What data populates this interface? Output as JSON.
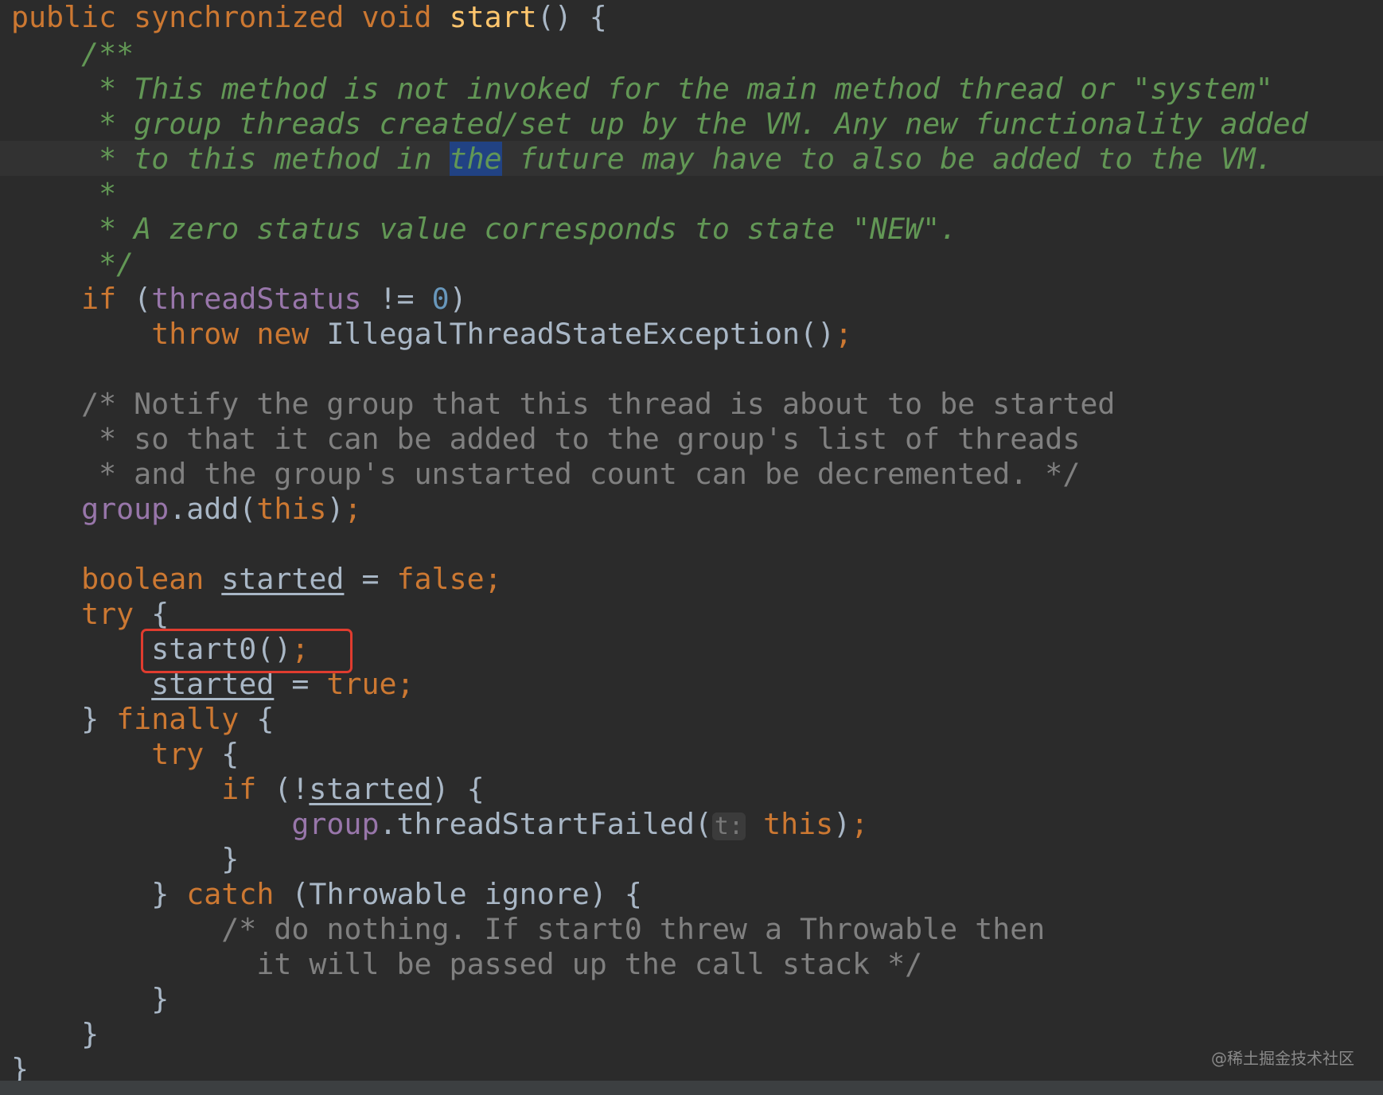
{
  "editor": {
    "watermark": "@稀土掘金技术社区",
    "hint_label": "t:"
  },
  "tokens": {
    "public": "public",
    "synchronized": "synchronized",
    "void": "void",
    "start_name": "start",
    "open_sig": "() {",
    "doc_open": "/**",
    "doc1": "* This method is not invoked for the main method thread or \"system\"",
    "doc2": "* group threads created/set up by the VM. Any new functionality added",
    "doc3a": "* to this method in ",
    "doc3_hl": "the",
    "doc3b": " future may have to also be added to the VM.",
    "doc4": "*",
    "doc5": "* A zero status value corresponds to state \"NEW\".",
    "doc_close": "*/",
    "if": "if",
    "paren_open": "(",
    "threadStatus": "threadStatus",
    "neq": " != ",
    "zero": "0",
    "paren_close": ")",
    "throw": "throw",
    "new": "new",
    "exception_call": "IllegalThreadStateException()",
    "semicolon": ";",
    "cm1": "/* Notify the group that this thread is about to be started",
    "cm2": "* so that it can be added to the group's list of threads",
    "cm3": "* and the group's unstarted count can be decremented. */",
    "group": "group",
    "add_call": ".add(",
    "this": "this",
    "close_paren": ")",
    "boolean": "boolean",
    "started": "started",
    "assign": " = ",
    "false": "false",
    "try": "try",
    "brace_open": " {",
    "start0_call": "start0()",
    "true": "true",
    "close_brace": "}",
    "finally": "finally",
    "if_not": " (!",
    "paren_brace": ") {",
    "threadStartFailed": ".threadStartFailed(",
    "catch": "catch",
    "catch_args": " (Throwable ignore) {",
    "cm4": "/* do nothing. If start0 threw a Throwable then",
    "cm5": "it will be passed up the call stack */"
  },
  "colors": {
    "background": "#2b2b2b",
    "keyword": "#cc7832",
    "method_declaration": "#ffc66d",
    "doc_comment": "#629755",
    "block_comment": "#808080",
    "field": "#9876aa",
    "number": "#6897bb",
    "text": "#a9b7c6",
    "highlight_box": "#e03c2f"
  }
}
